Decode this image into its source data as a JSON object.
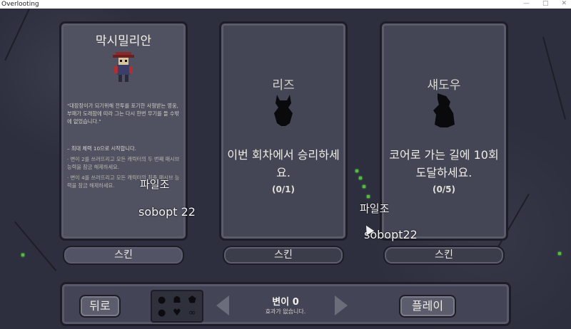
{
  "window": {
    "title": "Overlooting",
    "controls": [
      "—",
      "□",
      "✕"
    ]
  },
  "cards": [
    {
      "name": "막시밀리안",
      "unlocked": true,
      "description": "\"대장장이가 되기위해 전투를 포기한 사형받는 영웅, 부패가 도래함에 따라 그는 다시 한번 무기를 들 수밖에 없었습니다.\"",
      "bullets": [
        "– 최대 체력 10으로 시작합니다.",
        "· 변이 2를 쓰러뜨리고 모든 캐릭터의 두 번째 패시브 능력을 잠금 해제하세요.",
        "· 변이 4를 쓰러뜨리고 모든 캐릭터의 최종 패시브 능력을 잠금 해제하세요."
      ],
      "skin_label": "스킨"
    },
    {
      "name": "리즈",
      "unlocked": false,
      "quest": "이번 회차에서 승리하세요.",
      "progress": "(0/1)",
      "skin_label": "스킨"
    },
    {
      "name": "섀도우",
      "unlocked": false,
      "quest": "코어로 가는 길에 10회 도달하세요.",
      "progress": "(0/5)",
      "skin_label": "스킨"
    }
  ],
  "bottom": {
    "back_label": "뒤로",
    "play_label": "플레이",
    "difficulty_title": "변이 0",
    "difficulty_sub": "효과가 없습니다.",
    "mutation_icons": [
      "drop-icon",
      "skull-icon",
      "shield-icon",
      "flame-icon",
      "heart-icon",
      "infinity-icon"
    ]
  },
  "overlays": [
    {
      "text": "파일조"
    },
    {
      "text": "sobopt 22"
    },
    {
      "text": "파일조"
    },
    {
      "text": "sobopt22"
    }
  ],
  "colors": {
    "background": "#2d2f3e",
    "card": "#444656",
    "accent_vine": "#4fbf3a"
  }
}
